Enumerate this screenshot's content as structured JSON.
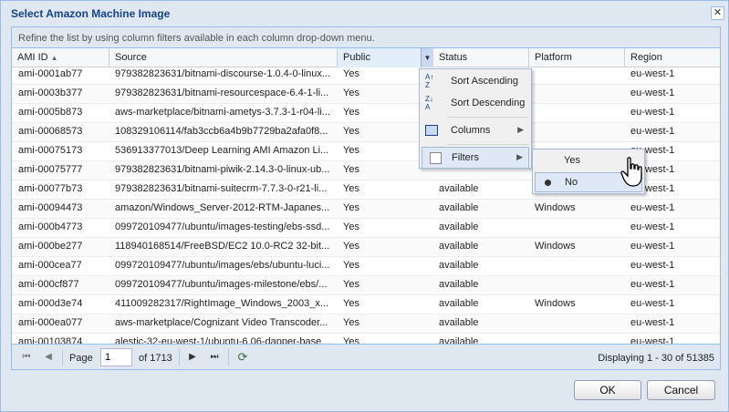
{
  "dialog": {
    "title": "Select Amazon Machine Image",
    "close_icon": "close-icon",
    "hint": "Refine the list by using column filters available in each column drop-down menu."
  },
  "columns": {
    "ami_id": "AMI ID",
    "source": "Source",
    "public": "Public",
    "status": "Status",
    "platform": "Platform",
    "region": "Region"
  },
  "rows": [
    {
      "ami": "ami-0001ab77",
      "source": "979382823631/bitnami-discourse-1.0.4-0-linux...",
      "public": "Yes",
      "status": "",
      "platform": "",
      "region": "eu-west-1"
    },
    {
      "ami": "ami-0003b377",
      "source": "979382823631/bitnami-resourcespace-6.4-1-li...",
      "public": "Yes",
      "status": "",
      "platform": "",
      "region": "eu-west-1"
    },
    {
      "ami": "ami-0005b873",
      "source": "aws-marketplace/bitnami-ametys-3.7.3-1-r04-li...",
      "public": "Yes",
      "status": "",
      "platform": "",
      "region": "eu-west-1"
    },
    {
      "ami": "ami-00068573",
      "source": "108329106114/fab3ccb6a4b9b7729ba2afa0f8...",
      "public": "Yes",
      "status": "",
      "platform": "",
      "region": "eu-west-1"
    },
    {
      "ami": "ami-00075173",
      "source": "536913377013/Deep Learning AMI Amazon Li...",
      "public": "Yes",
      "status": "",
      "platform": "",
      "region": "eu-west-1"
    },
    {
      "ami": "ami-00075777",
      "source": "979382823631/bitnami-piwik-2.14.3-0-linux-ub...",
      "public": "Yes",
      "status": "",
      "platform": "",
      "region": "eu-west-1"
    },
    {
      "ami": "ami-00077b73",
      "source": "979382823631/bitnami-suitecrm-7.7.3-0-r21-li...",
      "public": "Yes",
      "status": "available",
      "platform": "",
      "region": "eu-west-1"
    },
    {
      "ami": "ami-00094473",
      "source": "amazon/Windows_Server-2012-RTM-Japanes...",
      "public": "Yes",
      "status": "available",
      "platform": "Windows",
      "region": "eu-west-1"
    },
    {
      "ami": "ami-000b4773",
      "source": "099720109477/ubuntu/images-testing/ebs-ssd...",
      "public": "Yes",
      "status": "available",
      "platform": "",
      "region": "eu-west-1"
    },
    {
      "ami": "ami-000be277",
      "source": "118940168514/FreeBSD/EC2 10.0-RC2 32-bit...",
      "public": "Yes",
      "status": "available",
      "platform": "Windows",
      "region": "eu-west-1"
    },
    {
      "ami": "ami-000cea77",
      "source": "099720109477/ubuntu/images/ebs/ubuntu-luci...",
      "public": "Yes",
      "status": "available",
      "platform": "",
      "region": "eu-west-1"
    },
    {
      "ami": "ami-000cf877",
      "source": "099720109477/ubuntu/images-milestone/ebs/...",
      "public": "Yes",
      "status": "available",
      "platform": "",
      "region": "eu-west-1"
    },
    {
      "ami": "ami-000d3e74",
      "source": "411009282317/RightImage_Windows_2003_x...",
      "public": "Yes",
      "status": "available",
      "platform": "Windows",
      "region": "eu-west-1"
    },
    {
      "ami": "ami-000ea077",
      "source": "aws-marketplace/Cognizant Video Transcoder...",
      "public": "Yes",
      "status": "available",
      "platform": "",
      "region": "eu-west-1"
    },
    {
      "ami": "ami-00103874",
      "source": "alestic-32-eu-west-1/ubuntu-6.06-dapper-base...",
      "public": "Yes",
      "status": "available",
      "platform": "",
      "region": "eu-west-1"
    }
  ],
  "column_menu": {
    "sort_asc": "Sort Ascending",
    "sort_desc": "Sort Descending",
    "columns": "Columns",
    "filters": "Filters"
  },
  "filter_submenu": {
    "yes": "Yes",
    "no": "No",
    "selected": "No"
  },
  "pager": {
    "page_label": "Page",
    "page_value": "1",
    "of_label": "of 1713",
    "status": "Displaying 1 - 30 of 51385"
  },
  "buttons": {
    "ok": "OK",
    "cancel": "Cancel"
  }
}
